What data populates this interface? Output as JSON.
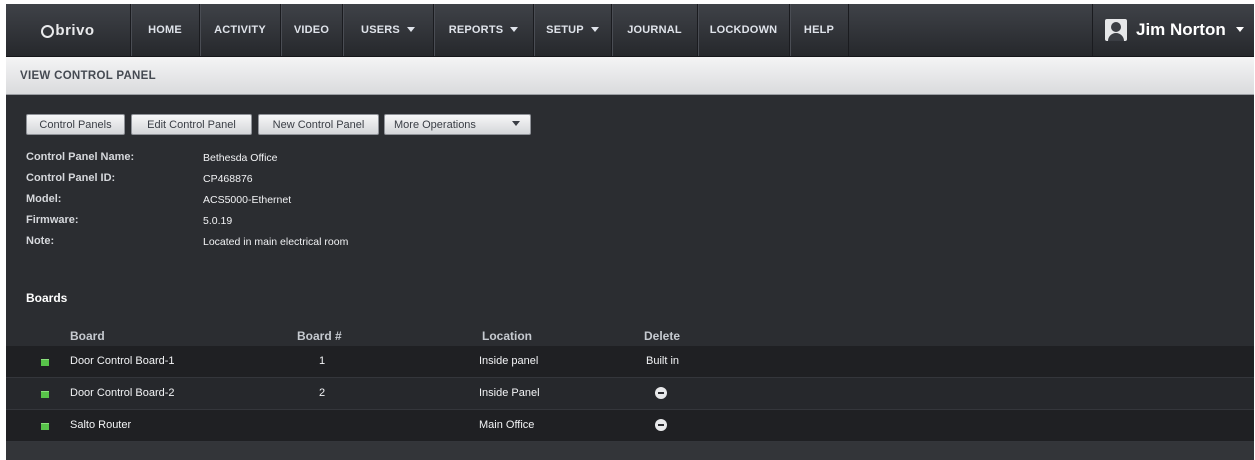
{
  "brand": {
    "name": "brivo"
  },
  "nav": {
    "items": [
      {
        "label": "HOME",
        "dropdown": false
      },
      {
        "label": "ACTIVITY",
        "dropdown": false
      },
      {
        "label": "VIDEO",
        "dropdown": false
      },
      {
        "label": "USERS",
        "dropdown": true
      },
      {
        "label": "REPORTS",
        "dropdown": true
      },
      {
        "label": "SETUP",
        "dropdown": true
      },
      {
        "label": "JOURNAL",
        "dropdown": false
      },
      {
        "label": "LOCKDOWN",
        "dropdown": false
      },
      {
        "label": "HELP",
        "dropdown": false
      }
    ],
    "user": {
      "name": "Jim Norton",
      "icon": "user-avatar-icon"
    }
  },
  "page": {
    "title": "VIEW CONTROL PANEL"
  },
  "actions": {
    "control_panels": "Control Panels",
    "edit_control_panel": "Edit Control Panel",
    "new_control_panel": "New Control Panel",
    "more_operations": "More Operations"
  },
  "details": {
    "name_label": "Control Panel Name:",
    "name_value": "Bethesda Office",
    "id_label": "Control Panel ID:",
    "id_value": "CP468876",
    "model_label": "Model:",
    "model_value": "ACS5000-Ethernet",
    "firmware_label": "Firmware:",
    "firmware_value": "5.0.19",
    "note_label": "Note:",
    "note_value": "Located in main electrical room"
  },
  "boards": {
    "section_title": "Boards",
    "columns": {
      "board": "Board",
      "number": "Board #",
      "location": "Location",
      "delete": "Delete"
    },
    "rows": [
      {
        "board": "Door Control Board-1",
        "number": "1",
        "location": "Inside panel",
        "delete_text": "Built in",
        "deletable": false
      },
      {
        "board": "Door Control Board-2",
        "number": "2",
        "location": "Inside Panel",
        "delete_text": "",
        "deletable": true
      },
      {
        "board": "Salto Router",
        "number": "",
        "location": "Main Office",
        "delete_text": "",
        "deletable": true
      }
    ]
  },
  "colors": {
    "background": "#2b2d31",
    "row_dark": "#1f2023",
    "row_alt": "#26282c",
    "board_icon": "#58c34a"
  }
}
